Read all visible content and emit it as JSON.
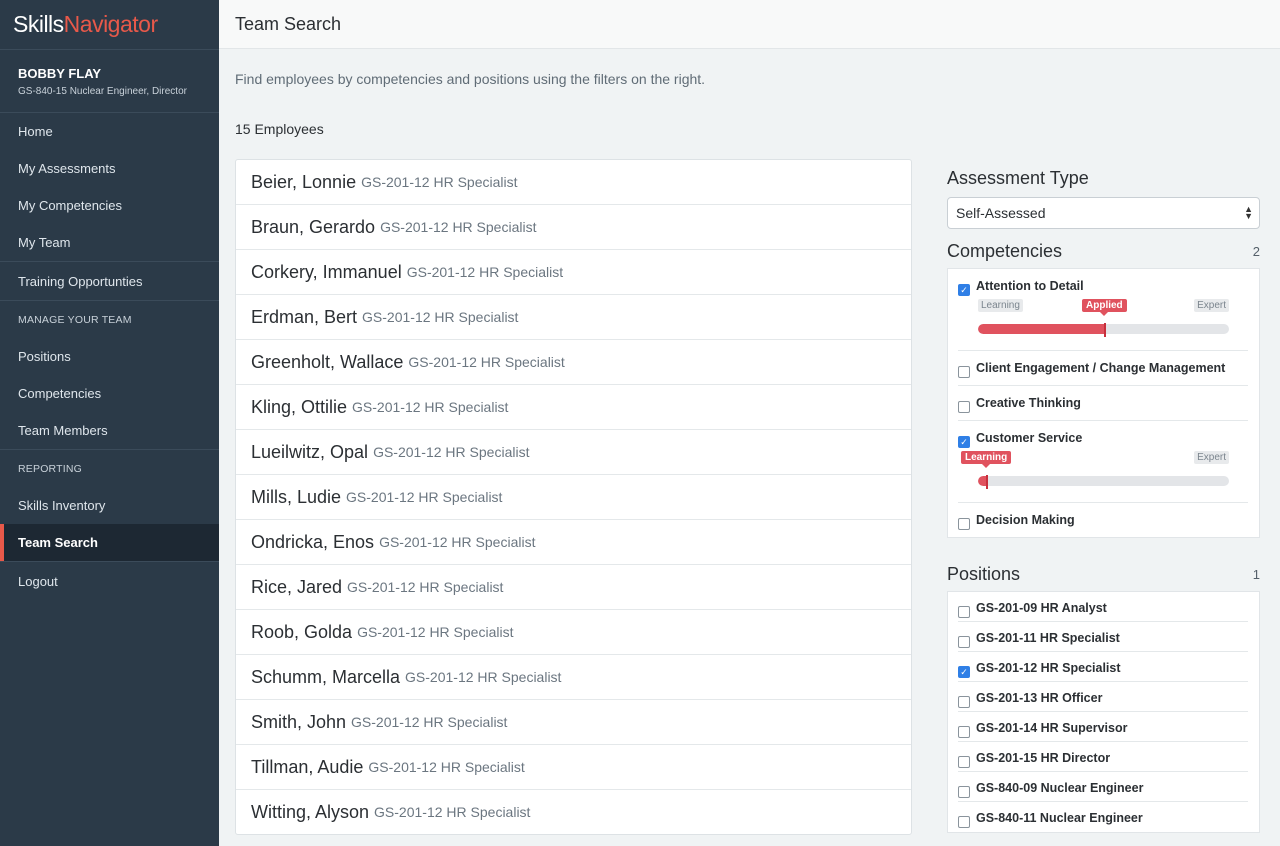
{
  "brand": {
    "part1": "Skills",
    "part2": "Navigator"
  },
  "user": {
    "name": "BOBBY FLAY",
    "title": "GS-840-15 Nuclear Engineer, Director"
  },
  "nav": {
    "home": "Home",
    "my_assessments": "My Assessments",
    "my_competencies": "My Competencies",
    "my_team": "My Team",
    "training": "Training Opportunties",
    "manage_heading": "MANAGE YOUR TEAM",
    "positions": "Positions",
    "competencies": "Competencies",
    "team_members": "Team Members",
    "reporting_heading": "REPORTING",
    "skills_inventory": "Skills Inventory",
    "team_search": "Team Search",
    "logout": "Logout"
  },
  "page": {
    "title": "Team Search",
    "intro": "Find employees by competencies and positions using the filters on the right.",
    "count": "15 Employees"
  },
  "employees": [
    {
      "name": "Beier, Lonnie",
      "position": "GS-201-12 HR Specialist"
    },
    {
      "name": "Braun, Gerardo",
      "position": "GS-201-12 HR Specialist"
    },
    {
      "name": "Corkery, Immanuel",
      "position": "GS-201-12 HR Specialist"
    },
    {
      "name": "Erdman, Bert",
      "position": "GS-201-12 HR Specialist"
    },
    {
      "name": "Greenholt, Wallace",
      "position": "GS-201-12 HR Specialist"
    },
    {
      "name": "Kling, Ottilie",
      "position": "GS-201-12 HR Specialist"
    },
    {
      "name": "Lueilwitz, Opal",
      "position": "GS-201-12 HR Specialist"
    },
    {
      "name": "Mills, Ludie",
      "position": "GS-201-12 HR Specialist"
    },
    {
      "name": "Ondricka, Enos",
      "position": "GS-201-12 HR Specialist"
    },
    {
      "name": "Rice, Jared",
      "position": "GS-201-12 HR Specialist"
    },
    {
      "name": "Roob, Golda",
      "position": "GS-201-12 HR Specialist"
    },
    {
      "name": "Schumm, Marcella",
      "position": "GS-201-12 HR Specialist"
    },
    {
      "name": "Smith, John",
      "position": "GS-201-12 HR Specialist"
    },
    {
      "name": "Tillman, Audie",
      "position": "GS-201-12 HR Specialist"
    },
    {
      "name": "Witting, Alyson",
      "position": "GS-201-12 HR Specialist"
    }
  ],
  "filters": {
    "assessment_heading": "Assessment Type",
    "assessment_value": "Self-Assessed",
    "competencies_heading": "Competencies",
    "competencies_count": "2",
    "competencies": [
      {
        "label": "Attention to Detail",
        "checked": true,
        "tag_left": "Learning",
        "tag_mid": "Applied",
        "tag_right": "Expert",
        "level": 0.5
      },
      {
        "label": "Client Engagement / Change Management",
        "checked": false
      },
      {
        "label": "Creative Thinking",
        "checked": false
      },
      {
        "label": "Customer Service",
        "checked": true,
        "tag_left": "Learning",
        "tag_right": "Expert",
        "level": 0.03
      },
      {
        "label": "Decision Making",
        "checked": false
      }
    ],
    "positions_heading": "Positions",
    "positions_count": "1",
    "positions": [
      {
        "label": "GS-201-09 HR Analyst",
        "checked": false
      },
      {
        "label": "GS-201-11 HR Specialist",
        "checked": false
      },
      {
        "label": "GS-201-12 HR Specialist",
        "checked": true
      },
      {
        "label": "GS-201-13 HR Officer",
        "checked": false
      },
      {
        "label": "GS-201-14 HR Supervisor",
        "checked": false
      },
      {
        "label": "GS-201-15 HR Director",
        "checked": false
      },
      {
        "label": "GS-840-09 Nuclear Engineer",
        "checked": false
      },
      {
        "label": "GS-840-11 Nuclear Engineer",
        "checked": false
      }
    ]
  },
  "colors": {
    "accent": "#e8594a",
    "sidebar": "#2b3a48",
    "checkbox": "#2f7fe6",
    "slider": "#e0525e"
  }
}
